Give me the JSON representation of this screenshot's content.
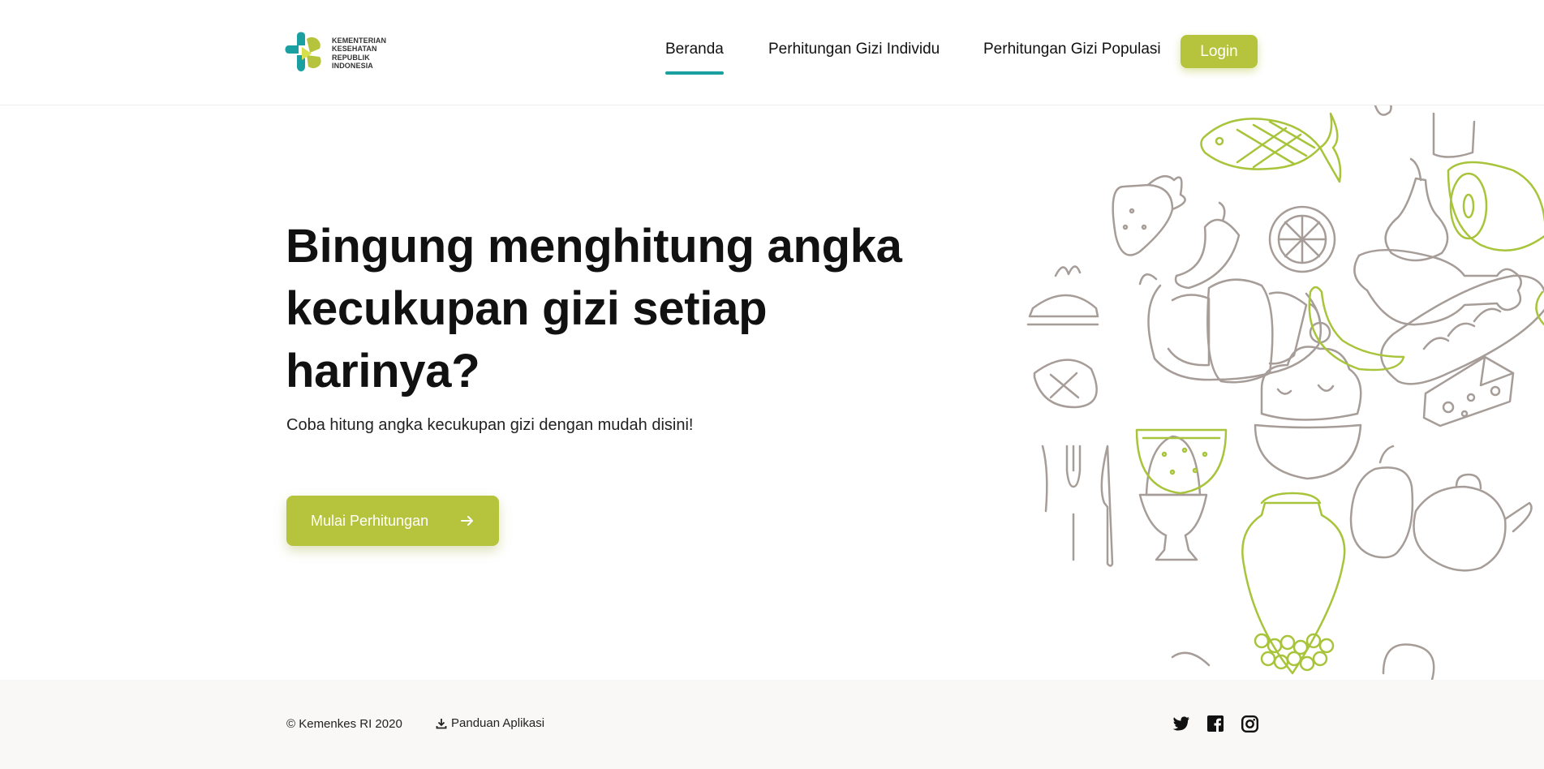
{
  "brand": {
    "logo_lines": [
      "KEMENTERIAN",
      "KESEHATAN",
      "REPUBLIK",
      "INDONESIA"
    ],
    "colors": {
      "teal": "#1aa0a0",
      "lime": "#b6c43d",
      "sketch_gray": "#a69c98",
      "sketch_green": "#a8c43b"
    }
  },
  "nav": {
    "items": [
      {
        "label": "Beranda",
        "active": true
      },
      {
        "label": "Perhitungan Gizi Individu",
        "active": false
      },
      {
        "label": "Perhitungan Gizi Populasi",
        "active": false
      }
    ],
    "login_label": "Login"
  },
  "hero": {
    "title": "Bingung menghitung angka kecukupan gizi setiap harinya?",
    "subtitle": "Coba hitung angka kecukupan gizi dengan mudah disini!",
    "cta_label": "Mulai Perhitungan",
    "cta_icon": "arrow-right-icon"
  },
  "footer": {
    "copyright": "© Kemenkes RI 2020",
    "guide_label": "Panduan Aplikasi",
    "guide_icon": "download-icon",
    "socials": [
      "twitter-icon",
      "facebook-icon",
      "instagram-icon"
    ]
  }
}
